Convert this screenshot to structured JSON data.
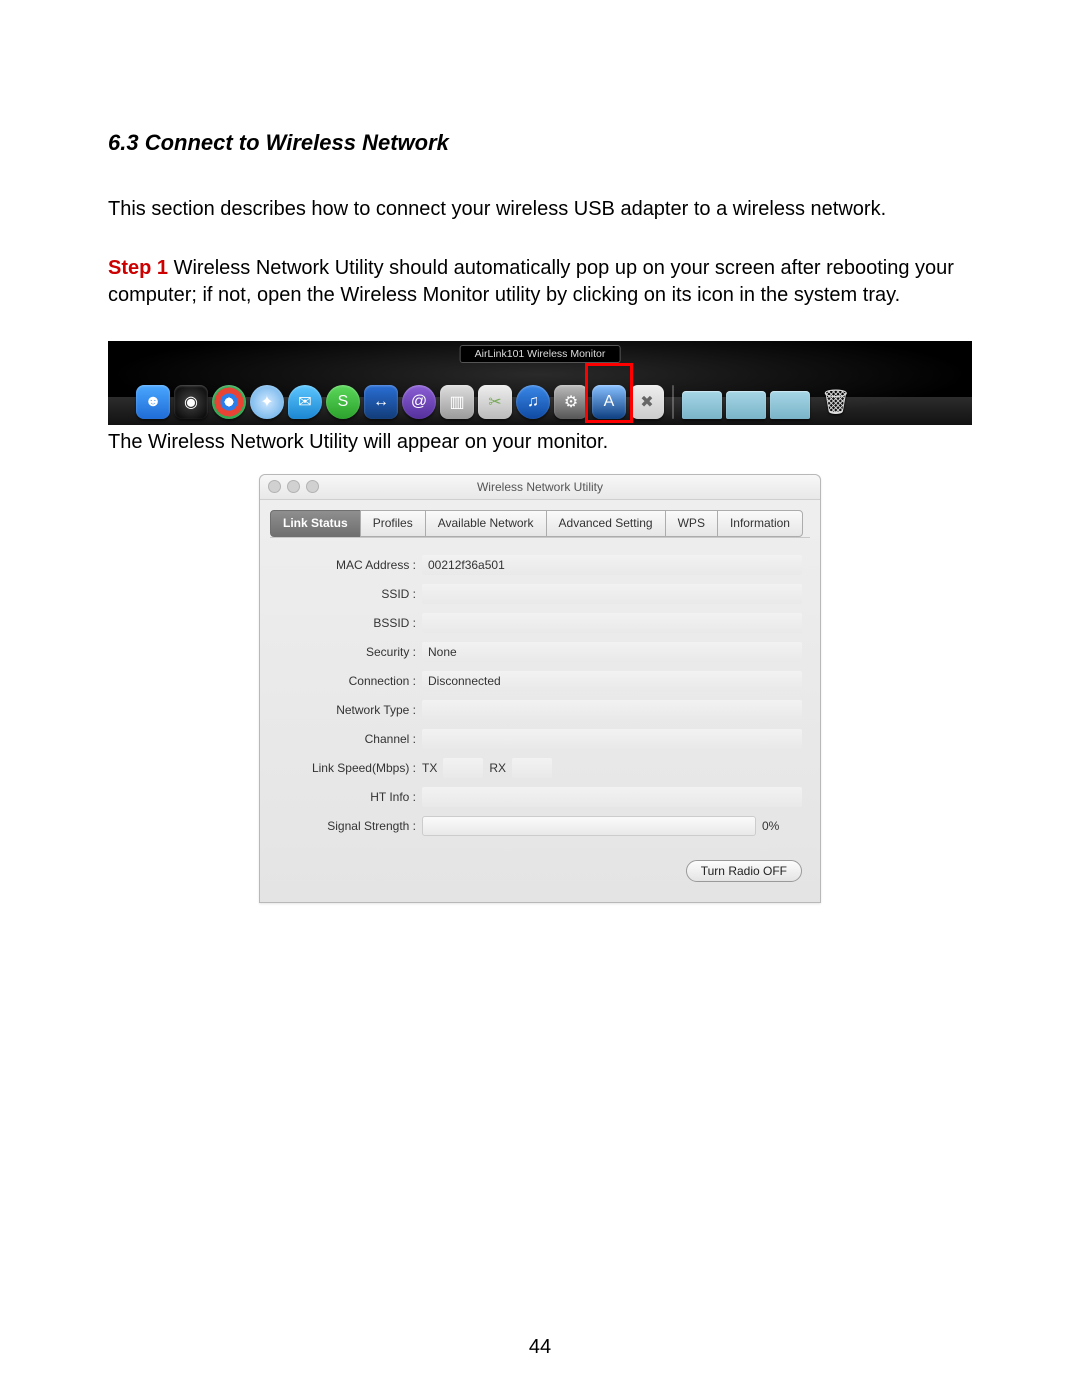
{
  "heading": "6.3 Connect to Wireless Network",
  "intro": "This section describes how to connect your wireless USB adapter to a wireless network.",
  "step1_label": "Step 1",
  "step1_text": " Wireless Network Utility should automatically pop up on your screen after rebooting your computer; if not, open the Wireless Monitor utility by clicking on its icon in the system tray.",
  "caption_after_dock": "The Wireless Network Utility will appear on your monitor.",
  "page_number": "44",
  "dock": {
    "tooltip": "AirLink101 Wireless Monitor",
    "icons": [
      {
        "name": "finder",
        "glyph": "☻"
      },
      {
        "name": "dashboard",
        "glyph": "◉"
      },
      {
        "name": "chrome",
        "glyph": ""
      },
      {
        "name": "safari",
        "glyph": "✦"
      },
      {
        "name": "ichat",
        "glyph": "✉"
      },
      {
        "name": "skype",
        "glyph": "S"
      },
      {
        "name": "teamviewer",
        "glyph": "↔"
      },
      {
        "name": "mail",
        "glyph": "@"
      },
      {
        "name": "preview",
        "glyph": "▥"
      },
      {
        "name": "grab",
        "glyph": "✂"
      },
      {
        "name": "itunes",
        "glyph": "♫"
      },
      {
        "name": "systempreferences",
        "glyph": "⚙"
      },
      {
        "name": "airlink",
        "glyph": "A"
      },
      {
        "name": "utilities",
        "glyph": "✖"
      }
    ]
  },
  "utility": {
    "title": "Wireless Network Utility",
    "tabs": [
      "Link Status",
      "Profiles",
      "Available Network",
      "Advanced Setting",
      "WPS",
      "Information"
    ],
    "active_tab_index": 0,
    "fields": {
      "mac_label": "MAC Address :",
      "mac_value": "00212f36a501",
      "ssid_label": "SSID :",
      "ssid_value": "",
      "bssid_label": "BSSID :",
      "bssid_value": "",
      "security_label": "Security :",
      "security_value": "None",
      "connection_label": "Connection :",
      "connection_value": "Disconnected",
      "network_type_label": "Network Type :",
      "network_type_value": "",
      "channel_label": "Channel :",
      "channel_value": "",
      "link_speed_label": "Link Speed(Mbps) :",
      "tx_label": "TX",
      "rx_label": "RX",
      "ht_label": "HT Info :",
      "ht_value": "",
      "signal_label": "Signal Strength :",
      "signal_pct": "0%"
    },
    "button": "Turn Radio OFF"
  }
}
